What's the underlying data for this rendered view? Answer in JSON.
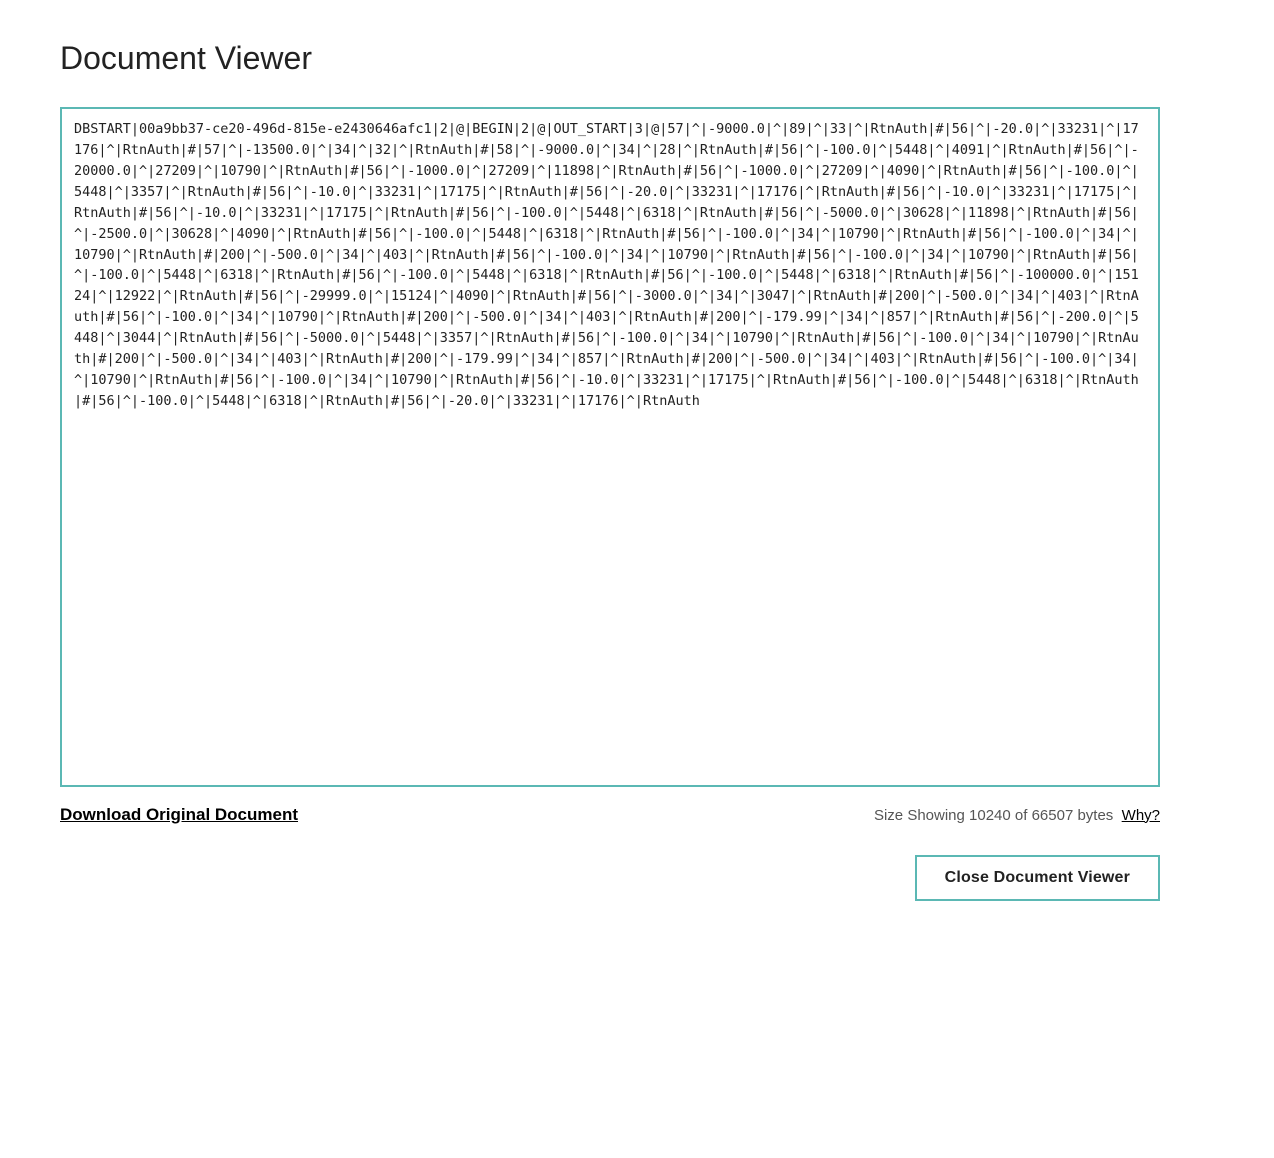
{
  "page": {
    "title": "Document Viewer",
    "document_content": "DBSTART|00a9bb37-ce20-496d-815e-e2430646afc1|2|@|BEGIN|2|@|OUT_START|3|@|57|^|-9000.0|^|89|^|33|^|RtnAuth|#|56|^|-20.0|^|33231|^|17176|^|RtnAuth|#|57|^|-13500.0|^|34|^|32|^|RtnAuth|#|58|^|-9000.0|^|34|^|28|^|RtnAuth|#|56|^|-100.0|^|5448|^|4091|^|RtnAuth|#|56|^|-20000.0|^|27209|^|10790|^|RtnAuth|#|56|^|-1000.0|^|27209|^|11898|^|RtnAuth|#|56|^|-1000.0|^|27209|^|4090|^|RtnAuth|#|56|^|-100.0|^|5448|^|3357|^|RtnAuth|#|56|^|-10.0|^|33231|^|17175|^|RtnAuth|#|56|^|-20.0|^|33231|^|17176|^|RtnAuth|#|56|^|-10.0|^|33231|^|17175|^|RtnAuth|#|56|^|-10.0|^|33231|^|17175|^|RtnAuth|#|56|^|-100.0|^|5448|^|6318|^|RtnAuth|#|56|^|-5000.0|^|30628|^|11898|^|RtnAuth|#|56|^|-2500.0|^|30628|^|4090|^|RtnAuth|#|56|^|-100.0|^|5448|^|6318|^|RtnAuth|#|56|^|-100.0|^|34|^|10790|^|RtnAuth|#|56|^|-100.0|^|34|^|10790|^|RtnAuth|#|200|^|-500.0|^|34|^|403|^|RtnAuth|#|56|^|-100.0|^|34|^|10790|^|RtnAuth|#|56|^|-100.0|^|34|^|10790|^|RtnAuth|#|56|^|-100.0|^|5448|^|6318|^|RtnAuth|#|56|^|-100.0|^|5448|^|6318|^|RtnAuth|#|56|^|-100.0|^|5448|^|6318|^|RtnAuth|#|56|^|-100000.0|^|15124|^|12922|^|RtnAuth|#|56|^|-29999.0|^|15124|^|4090|^|RtnAuth|#|56|^|-3000.0|^|34|^|3047|^|RtnAuth|#|200|^|-500.0|^|34|^|403|^|RtnAuth|#|56|^|-100.0|^|34|^|10790|^|RtnAuth|#|200|^|-500.0|^|34|^|403|^|RtnAuth|#|200|^|-179.99|^|34|^|857|^|RtnAuth|#|56|^|-200.0|^|5448|^|3044|^|RtnAuth|#|56|^|-5000.0|^|5448|^|3357|^|RtnAuth|#|56|^|-100.0|^|34|^|10790|^|RtnAuth|#|56|^|-100.0|^|34|^|10790|^|RtnAuth|#|200|^|-500.0|^|34|^|403|^|RtnAuth|#|200|^|-179.99|^|34|^|857|^|RtnAuth|#|200|^|-500.0|^|34|^|403|^|RtnAuth|#|56|^|-100.0|^|34|^|10790|^|RtnAuth|#|56|^|-100.0|^|34|^|10790|^|RtnAuth|#|56|^|-10.0|^|33231|^|17175|^|RtnAuth|#|56|^|-100.0|^|5448|^|6318|^|RtnAuth|#|56|^|-100.0|^|5448|^|6318|^|RtnAuth|#|56|^|-20.0|^|33231|^|17176|^|RtnAuth",
    "download_label": "Download Original Document",
    "size_label": "Size Showing 10240 of 66507 bytes",
    "why_label": "Why?",
    "close_button_label": "Close Document Viewer"
  }
}
